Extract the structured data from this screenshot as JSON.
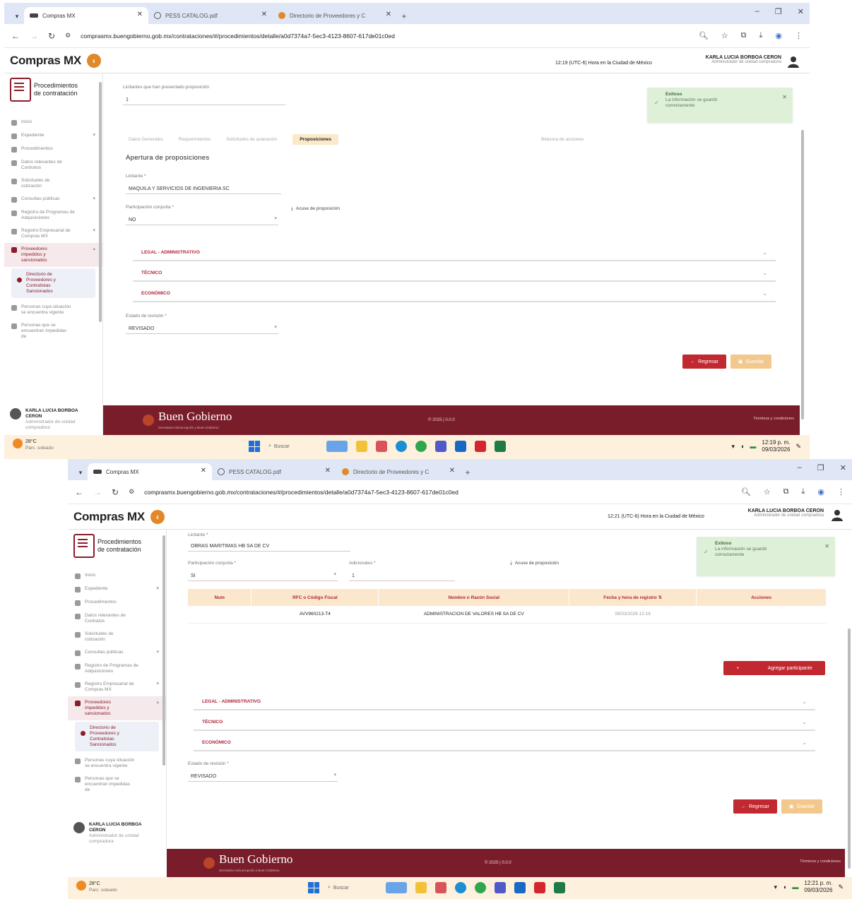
{
  "browser": {
    "tabs": [
      {
        "title": "Compras MX",
        "active": true
      },
      {
        "title": "PESS CATALOG.pdf",
        "active": false
      },
      {
        "title": "Directorio de Proveedores y C",
        "active": false
      }
    ],
    "url_1": "comprasmx.buengobierno.gob.mx/contrataciones/#/procedimientos/detalle/a0d7374a7-5ec3-4123-8607-617de01c0ed",
    "url_2": "comprasmx.buengobierno.gob.mx/contrataciones/#/procedimientos/detalle/a0d7374a7-5ec3-4123-8607-617de01c0ed"
  },
  "header": {
    "logo_text": "Compras MX",
    "timezone_1": "12:19 (UTC-6) Hora en la Ciudad de México",
    "timezone_2": "12:21 (UTC-6) Hora en la Ciudad de México",
    "user_name": "KARLA LUCIA BORBOA CERON",
    "user_role": "Administrador de unidad compradora"
  },
  "sidebar": {
    "title_line1": "Procedimientos",
    "title_line2": "de contratación",
    "items": [
      {
        "label": "Inicio",
        "chev": ""
      },
      {
        "label": "Expediente",
        "chev": "▾"
      },
      {
        "label": "Procedimientos",
        "chev": ""
      },
      {
        "label": "Datos relevantes de Contratos",
        "chev": ""
      },
      {
        "label": "Solicitudes de cotización",
        "chev": ""
      },
      {
        "label": "Consultas públicas",
        "chev": "▾"
      },
      {
        "label": "Registro de Programas de Adquisiciones",
        "chev": ""
      },
      {
        "label": "Registro Empresarial de Compras MX",
        "chev": "▾"
      },
      {
        "label": "Proveedores impedidos y sancionados",
        "chev": "▴",
        "active": true
      }
    ],
    "sub_item": "Directorio de Proveedores y Contratistas Sancionados",
    "extra_items": [
      {
        "label": "Personas cuya situación se encuentra vigente"
      },
      {
        "label": "Personas que se encuentran impedidas de"
      }
    ],
    "user_name": "KARLA LUCIA BORBOA CERON",
    "user_role": "Administrador de unidad compradora"
  },
  "screen1": {
    "bidders_label": "Licitantes que han presentado proposición",
    "bidders_value": "1",
    "tabs": [
      "Datos Generales",
      "Requerimientos",
      "Solicitudes de aclaración",
      "Proposiciones",
      "Bitácora de acciones"
    ],
    "active_tab": "Proposiciones",
    "section_title": "Apertura de proposiciones",
    "bidder_label": "Licitante *",
    "bidder_value": "MAQUILA Y SERVICIOS DE INGENIERIA SC",
    "joint_label": "Participación conjunta *",
    "joint_value": "NO",
    "receipt_label": "Acuse de proposición",
    "accordions": [
      "LEGAL - ADMINISTRATIVO",
      "TÉCNICO",
      "ECONÓMICO"
    ],
    "review_label": "Estado de revisión *",
    "review_value": "REVISADO",
    "back_button": "Regresar",
    "save_button": "Guardar",
    "toast_title": "Exitoso",
    "toast_text": "La información se guardó correctamente"
  },
  "screen2": {
    "bidder_label": "Licitante *",
    "bidder_value": "OBRAS MARITIMAS HB SA DE CV",
    "joint_label": "Participación conjunta *",
    "joint_value": "SI",
    "additional_label": "Adicionales *",
    "additional_value": "1",
    "receipt_label": "Acuse de proposición",
    "table": {
      "headers": [
        "Num",
        "RFC o Código Fiscal",
        "Nombre o Razón Social",
        "Fecha y hora de registro",
        "Acciones"
      ],
      "rows": [
        [
          "",
          "AVV960213-T4",
          "ADMINISTRACION DE VALORES HB SA DE CV",
          "09/03/2026 12:19",
          ""
        ]
      ]
    },
    "add_button": "Agregar participante",
    "accordions": [
      "LEGAL - ADMINISTRATIVO",
      "TÉCNICO",
      "ECONÓMICO"
    ],
    "review_label": "Estado de revisión *",
    "review_value": "REVISADO",
    "back_button": "Regresar",
    "save_button": "Guardar",
    "toast_title": "Exitoso",
    "toast_text": "La información se guardó correctamente"
  },
  "footer": {
    "brand": "Buen Gobierno",
    "brand_sub": "Secretaría Anticorrupción y Buen Gobierno",
    "copyright": "© 2025 | 0.0.0",
    "terms": "Términos y condiciones"
  },
  "taskbar": {
    "temp": "28°C",
    "weather": "Parc. soleado",
    "search": "Buscar",
    "time_1": "12:19 p. m.",
    "date_1": "09/03/2026",
    "time_2": "12:21 p. m.",
    "date_2": "09/03/2026"
  },
  "colors": {
    "brand_red": "#b2263a",
    "footer": "#7a1d2a",
    "accent_orange": "#e1892a",
    "success": "#dff0d8"
  }
}
